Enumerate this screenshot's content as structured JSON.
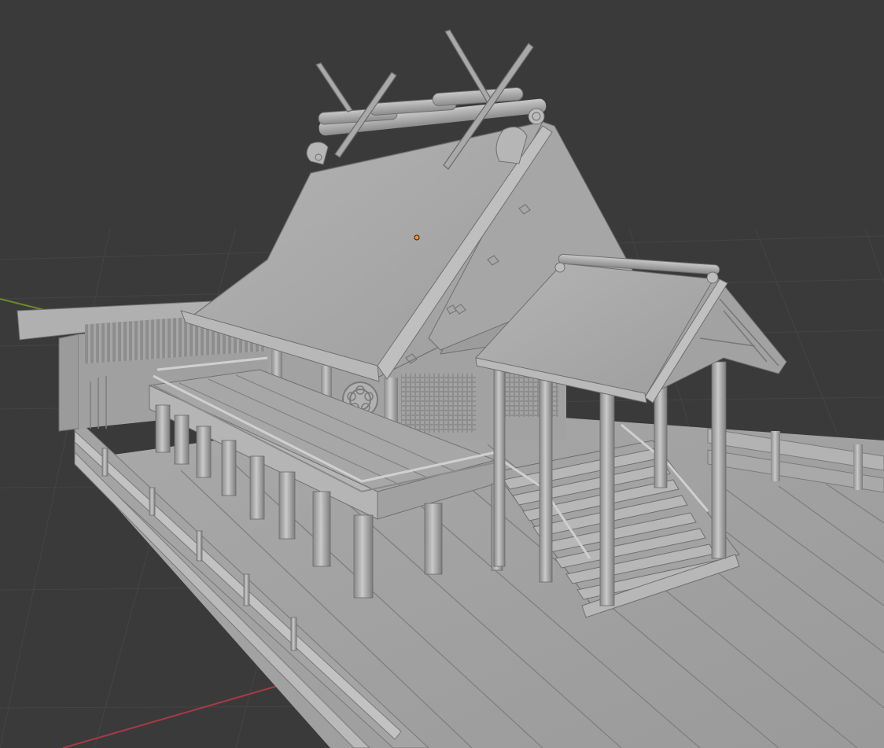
{
  "viewport": {
    "background_color": "#3a3a3a",
    "grid_color": "#454545",
    "x_axis_color": "#a83a45",
    "y_axis_color": "#6c8a2c",
    "model_color": "#a8a8a8",
    "origin_marker_color": "#ff8f1f",
    "shading": "solid"
  },
  "scene": {
    "model": "shinto-shrine",
    "parts": [
      "main-roof",
      "chigi-crossed-finials",
      "katsuogi-logs",
      "gable",
      "crest-disc",
      "lattice-doors",
      "veranda",
      "veranda-railing",
      "stair-canopy-roof",
      "canopy-pillars",
      "staircase",
      "stair-handrails",
      "side-wing",
      "slatted-screen",
      "floor-deck",
      "deck-railing"
    ]
  }
}
